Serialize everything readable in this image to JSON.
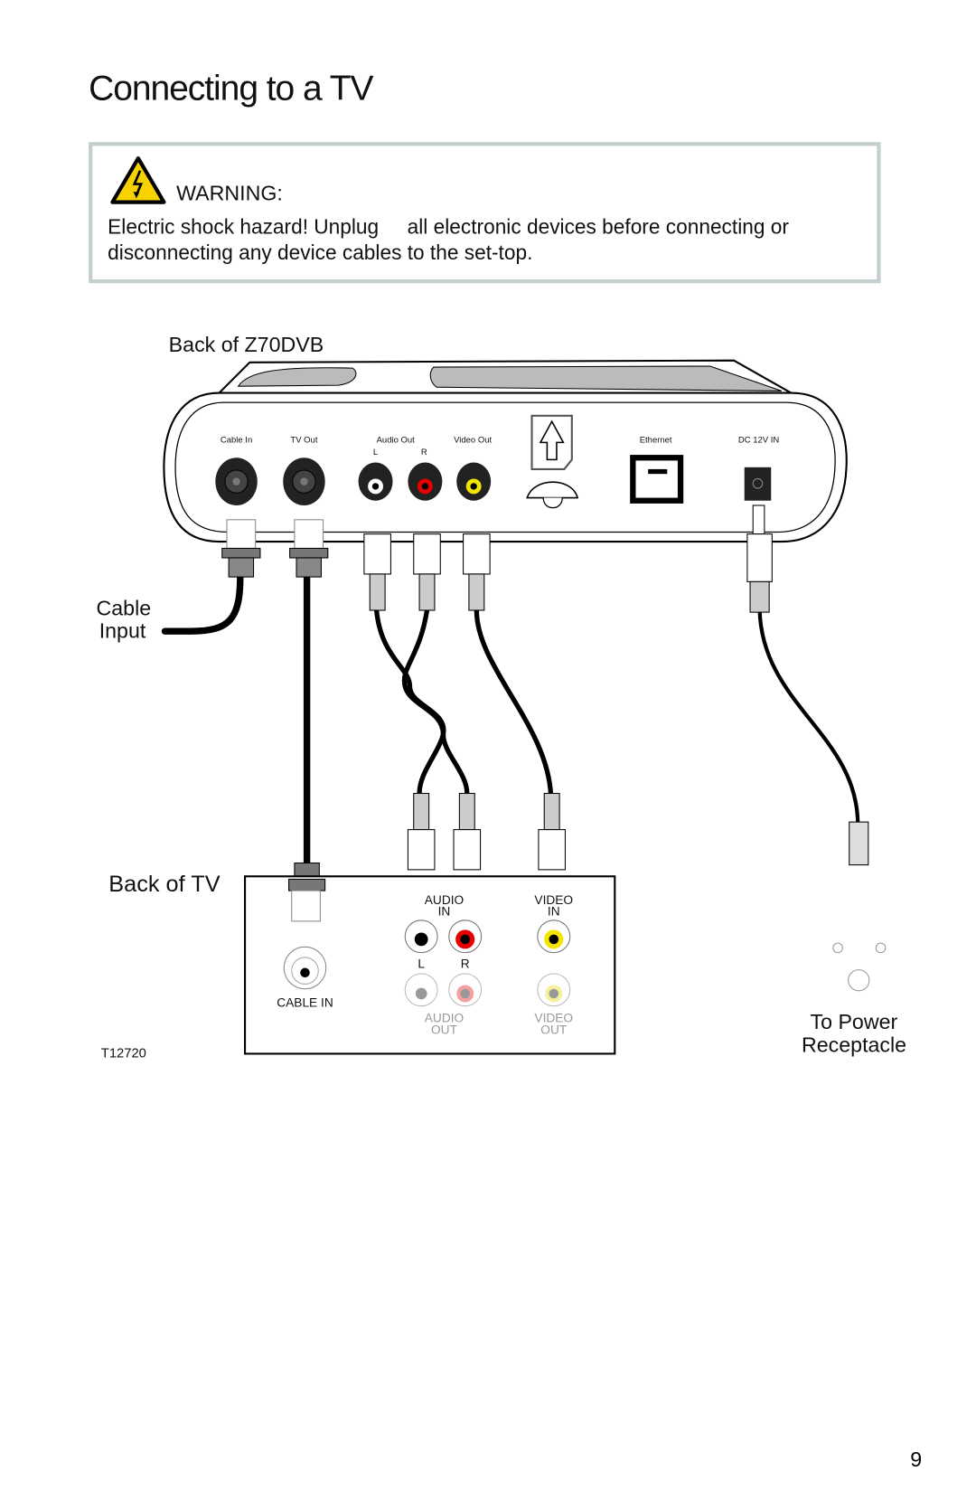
{
  "page": {
    "title": "Connecting to a TV",
    "page_number": "9"
  },
  "warning": {
    "icon": "electric-shock-warning-icon",
    "heading": "WARNING:",
    "line1": "Electric shock hazard! Unplug     all electronic devices before connecting or",
    "line2": "disconnecting any device cables to the set-top.",
    "border_color": "#c3cfcf",
    "icon_color": "#f6d200"
  },
  "settop": {
    "caption": "Back of Z70DVB",
    "ports": {
      "cable_in": "Cable In",
      "tv_out": "TV Out",
      "audio_out": "Audio Out",
      "audio_l": "L",
      "audio_r": "R",
      "video_out": "Video Out",
      "ethernet": "Ethernet",
      "dc_in": "DC 12V IN"
    }
  },
  "labels": {
    "cable_input_1": "Cable",
    "cable_input_2": "Input",
    "back_of_tv": "Back of TV",
    "to_power_1": "To Power",
    "to_power_2": "Receptacle",
    "figure_id": "T12720"
  },
  "tv": {
    "audio_in_1": "AUDIO",
    "audio_in_2": "IN",
    "video_in_1": "VIDEO",
    "video_in_2": "IN",
    "l": "L",
    "r": "R",
    "cable_in": "CABLE IN",
    "audio_out_1": "AUDIO",
    "audio_out_2": "OUT",
    "video_out_1": "VIDEO",
    "video_out_2": "OUT"
  },
  "colors": {
    "red": "#e60000",
    "yellow": "#f2e600",
    "white": "#ffffff"
  }
}
